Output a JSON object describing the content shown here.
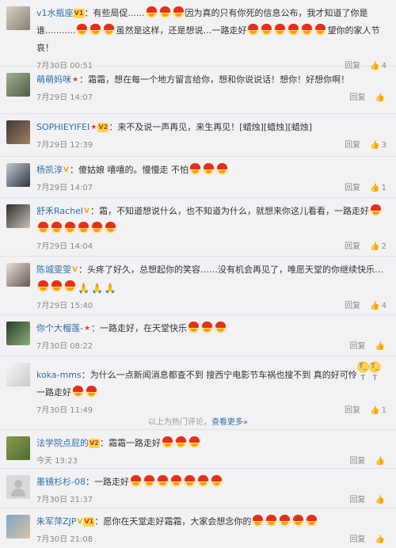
{
  "comments": [
    {
      "user": "v1水瓶座",
      "segments": [
        {
          "t": "text",
          "v": "有些局促"
        },
        {
          "t": "dots",
          "v": "......"
        },
        {
          "t": "emo",
          "n": 3
        },
        {
          "t": "text",
          "v": "因为真的只有你死的信息公布，我才知道了你是谁"
        },
        {
          "t": "dots",
          "v": "..........."
        },
        {
          "t": "emo",
          "n": 3
        },
        {
          "t": "text",
          "v": "虽然是这样，还是想说…一路走好"
        },
        {
          "t": "emo",
          "n": 6
        },
        {
          "t": "text",
          "v": "望你的家人节哀！"
        }
      ],
      "date": "7月30日 00:51",
      "reply": "回复",
      "likes": "4"
    },
    {
      "user": "萌萌妈咪",
      "segments": [
        {
          "t": "text",
          "v": "霜霜，想在每一个地方留言给你，想和你说说话！想你！好想你啊！"
        }
      ],
      "date": "7月29日 14:07",
      "reply": "回复",
      "likes": ""
    },
    {
      "user": "SOPHIEYIFEI",
      "segments": [
        {
          "t": "text",
          "v": "来不及说一声再见，来生再见！[蜡烛][蜡烛][蜡烛]"
        }
      ],
      "date": "7月29日 12:39",
      "reply": "回复",
      "likes": "3"
    },
    {
      "user": "杨凯淳",
      "segments": [
        {
          "t": "text",
          "v": "傻姑娘 嘻嘻的。慢慢走 不怕"
        },
        {
          "t": "emo",
          "n": 3
        }
      ],
      "date": "7月29日 14:07",
      "reply": "回复",
      "likes": "1"
    },
    {
      "user": "舒禾Rachel",
      "segments": [
        {
          "t": "text",
          "v": "霜，不知道想说什么，也不知道为什么，就想来你这儿看看，一路走好"
        },
        {
          "t": "emo",
          "n": 7
        }
      ],
      "date": "7月29日 14:04",
      "reply": "回复",
      "likes": "2"
    },
    {
      "user": "陈城雯雯",
      "segments": [
        {
          "t": "text",
          "v": "头疼了好久，总想起你的笑容……没有机会再见了，唯愿天堂的你继续快乐…"
        },
        {
          "t": "emo",
          "n": 3
        },
        {
          "t": "pray",
          "n": 3
        }
      ],
      "date": "7月29日 15:40",
      "reply": "回复",
      "likes": "4"
    },
    {
      "user": "你个大榴莲-",
      "segments": [
        {
          "t": "text",
          "v": "一路走好，在天堂快乐"
        },
        {
          "t": "emo",
          "n": 3
        }
      ],
      "date": "7月30日 08:22",
      "reply": "回复",
      "likes": ""
    },
    {
      "user": "koka-mms",
      "segments": [
        {
          "t": "text",
          "v": "为什么一点新闻消息都查不到 搜西宁电影节车祸也搜不到 真的好可怜"
        },
        {
          "t": "cry",
          "n": 2
        },
        {
          "t": "text",
          "v": "一路走好"
        },
        {
          "t": "emo",
          "n": 2
        }
      ],
      "date": "7月30日 11:49",
      "reply": "回复",
      "likes": "1"
    },
    {
      "user": "法学院点屁的",
      "segments": [
        {
          "t": "text",
          "v": "霜霜一路走好"
        },
        {
          "t": "emo",
          "n": 3
        }
      ],
      "date": "今天 13:23",
      "reply": "回复",
      "likes": ""
    },
    {
      "user": "墨镜杉杉-08",
      "segments": [
        {
          "t": "text",
          "v": "一路走好"
        },
        {
          "t": "emo",
          "n": 7
        }
      ],
      "date": "7月30日 21:37",
      "reply": "回复",
      "likes": ""
    },
    {
      "user": "朱军萍ZJP",
      "segments": [
        {
          "t": "text",
          "v": "愿你在天堂走好霜霜，大家会想念你的"
        },
        {
          "t": "emo",
          "n": 5
        }
      ],
      "date": "7月30日 21:08",
      "reply": "回复",
      "likes": ""
    }
  ],
  "hot_divider": {
    "text": "以上为热门评论，",
    "more": "查看更多»"
  },
  "icons": {
    "like": "thumbs-up-icon",
    "emoji": "candle-emoji-icon",
    "pray": "praying-hands-icon",
    "cry": "crying-face-icon"
  },
  "colors": {
    "username": "#2f6fa4",
    "background": "#f2f2f5",
    "meta": "#888888",
    "star_badge": "#e43b2b",
    "v_badge": "#f3a712"
  }
}
